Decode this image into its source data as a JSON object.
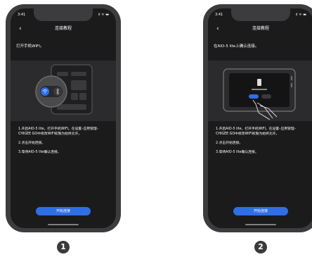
{
  "screens": [
    {
      "status_time": "3:41",
      "status_icons": "ıl ᯤ ▬",
      "nav_title": "连接教程",
      "back_glyph": "‹",
      "heading": "打开手机WIFI。",
      "instructions": [
        "1.开启AIO-5 lite，打开手机WIFI。在设置–应用管理–CHIGEE GO中修改WIFI权限为始终允许。",
        "2.点击开始连接。",
        "3.等待AIO-5 lite确认连接。"
      ],
      "button_label": "开始连接",
      "badge": "1"
    },
    {
      "status_time": "3:41",
      "status_icons": "ıl ᯤ ▬",
      "nav_title": "连接教程",
      "back_glyph": "‹",
      "heading": "在AIO-5 lite上确认连接。",
      "instructions": [
        "1.开启AIO-5 lite，打开手机WIFI。在设置–应用管理–CHIGEE GO中修改WIFI权限为始终允许。",
        "2.点击开始连接。",
        "3.等待AIO-5 lite确认连接。"
      ],
      "button_label": "开始连接",
      "badge": "2"
    }
  ],
  "colors": {
    "phone_frame": "#3c3c3e",
    "screen_bg": "#1b1b1c",
    "button_blue": "#2f6ee6",
    "wifi_blue": "#2f6ee6"
  }
}
